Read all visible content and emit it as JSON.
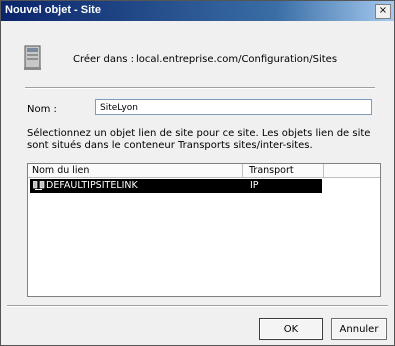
{
  "window": {
    "title": "Nouvel objet - Site",
    "close_glyph": "×"
  },
  "header": {
    "icon": "site-object-icon",
    "create_label": "Créer dans :",
    "create_path": "local.entreprise.com/Configuration/Sites"
  },
  "name_field": {
    "label": "Nom :",
    "value": "SiteLyon"
  },
  "instructions": "Sélectionnez un objet lien de site pour ce site. Les objets lien de site sont situés dans le conteneur Transports sites/inter-sites.",
  "site_links": {
    "columns": [
      "Nom du lien",
      "Transport"
    ],
    "rows": [
      {
        "icon": "site-link-icon",
        "name": "DEFAULTIPSITELINK",
        "transport": "IP",
        "selected": true
      }
    ]
  },
  "buttons": {
    "ok": "OK",
    "cancel": "Annuler"
  }
}
